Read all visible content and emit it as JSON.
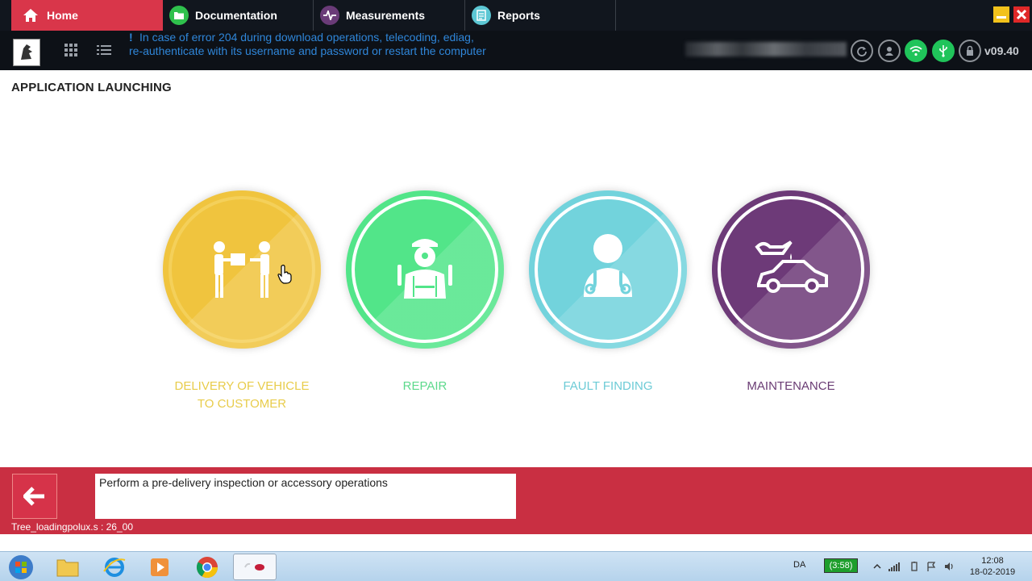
{
  "tabs": [
    {
      "label": "Home",
      "icon": "home-icon"
    },
    {
      "label": "Documentation",
      "icon": "folder-icon"
    },
    {
      "label": "Measurements",
      "icon": "waveform-icon"
    },
    {
      "label": "Reports",
      "icon": "report-icon"
    }
  ],
  "header": {
    "notice_mark": "!",
    "notice_line1": "In case of error 204 during download operations, telecoding, ediag,",
    "notice_line2": "re-authenticate with its username and password or restart the computer",
    "version": "v09.40"
  },
  "main": {
    "title": "APPLICATION LAUNCHING",
    "apps": [
      {
        "line1": "DELIVERY OF VEHICLE",
        "line2": "TO CUSTOMER",
        "color": "#f0c43e",
        "icon": "handover-icon"
      },
      {
        "line1": "REPAIR",
        "line2": "",
        "color": "#52e589",
        "icon": "mechanic-icon"
      },
      {
        "line1": "FAULT FINDING",
        "line2": "",
        "color": "#72d3dc",
        "icon": "doctor-icon"
      },
      {
        "line1": "MAINTENANCE",
        "line2": "",
        "color": "#6d3a78",
        "icon": "oil-car-icon"
      }
    ]
  },
  "bottom": {
    "description": "Perform a pre-delivery inspection or accessory operations",
    "status": "Tree_loadingpolux.s : 26_00"
  },
  "taskbar": {
    "lang": "DA",
    "battery": "(3:58)",
    "time": "12:08",
    "date": "18-02-2019"
  },
  "colors": {
    "accent_red": "#c92f42",
    "tab_active": "#d9364a",
    "notice_blue": "#2f86d9",
    "label_delivery": "#e8cc4a",
    "label_repair": "#5dd98c",
    "label_fault": "#6ccbd6",
    "label_maintenance": "#6a3c74"
  }
}
